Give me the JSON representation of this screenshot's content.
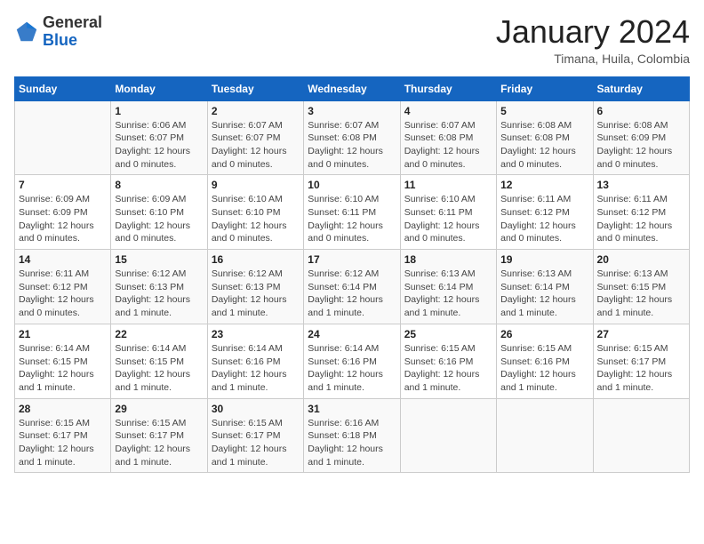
{
  "header": {
    "logo": {
      "general": "General",
      "blue": "Blue"
    },
    "title": "January 2024",
    "location": "Timana, Huila, Colombia"
  },
  "calendar": {
    "weekdays": [
      "Sunday",
      "Monday",
      "Tuesday",
      "Wednesday",
      "Thursday",
      "Friday",
      "Saturday"
    ],
    "weeks": [
      [
        {
          "day": "",
          "info": ""
        },
        {
          "day": "1",
          "info": "Sunrise: 6:06 AM\nSunset: 6:07 PM\nDaylight: 12 hours\nand 0 minutes."
        },
        {
          "day": "2",
          "info": "Sunrise: 6:07 AM\nSunset: 6:07 PM\nDaylight: 12 hours\nand 0 minutes."
        },
        {
          "day": "3",
          "info": "Sunrise: 6:07 AM\nSunset: 6:08 PM\nDaylight: 12 hours\nand 0 minutes."
        },
        {
          "day": "4",
          "info": "Sunrise: 6:07 AM\nSunset: 6:08 PM\nDaylight: 12 hours\nand 0 minutes."
        },
        {
          "day": "5",
          "info": "Sunrise: 6:08 AM\nSunset: 6:08 PM\nDaylight: 12 hours\nand 0 minutes."
        },
        {
          "day": "6",
          "info": "Sunrise: 6:08 AM\nSunset: 6:09 PM\nDaylight: 12 hours\nand 0 minutes."
        }
      ],
      [
        {
          "day": "7",
          "info": "Sunrise: 6:09 AM\nSunset: 6:09 PM\nDaylight: 12 hours\nand 0 minutes."
        },
        {
          "day": "8",
          "info": "Sunrise: 6:09 AM\nSunset: 6:10 PM\nDaylight: 12 hours\nand 0 minutes."
        },
        {
          "day": "9",
          "info": "Sunrise: 6:10 AM\nSunset: 6:10 PM\nDaylight: 12 hours\nand 0 minutes."
        },
        {
          "day": "10",
          "info": "Sunrise: 6:10 AM\nSunset: 6:11 PM\nDaylight: 12 hours\nand 0 minutes."
        },
        {
          "day": "11",
          "info": "Sunrise: 6:10 AM\nSunset: 6:11 PM\nDaylight: 12 hours\nand 0 minutes."
        },
        {
          "day": "12",
          "info": "Sunrise: 6:11 AM\nSunset: 6:12 PM\nDaylight: 12 hours\nand 0 minutes."
        },
        {
          "day": "13",
          "info": "Sunrise: 6:11 AM\nSunset: 6:12 PM\nDaylight: 12 hours\nand 0 minutes."
        }
      ],
      [
        {
          "day": "14",
          "info": "Sunrise: 6:11 AM\nSunset: 6:12 PM\nDaylight: 12 hours\nand 0 minutes."
        },
        {
          "day": "15",
          "info": "Sunrise: 6:12 AM\nSunset: 6:13 PM\nDaylight: 12 hours\nand 1 minute."
        },
        {
          "day": "16",
          "info": "Sunrise: 6:12 AM\nSunset: 6:13 PM\nDaylight: 12 hours\nand 1 minute."
        },
        {
          "day": "17",
          "info": "Sunrise: 6:12 AM\nSunset: 6:14 PM\nDaylight: 12 hours\nand 1 minute."
        },
        {
          "day": "18",
          "info": "Sunrise: 6:13 AM\nSunset: 6:14 PM\nDaylight: 12 hours\nand 1 minute."
        },
        {
          "day": "19",
          "info": "Sunrise: 6:13 AM\nSunset: 6:14 PM\nDaylight: 12 hours\nand 1 minute."
        },
        {
          "day": "20",
          "info": "Sunrise: 6:13 AM\nSunset: 6:15 PM\nDaylight: 12 hours\nand 1 minute."
        }
      ],
      [
        {
          "day": "21",
          "info": "Sunrise: 6:14 AM\nSunset: 6:15 PM\nDaylight: 12 hours\nand 1 minute."
        },
        {
          "day": "22",
          "info": "Sunrise: 6:14 AM\nSunset: 6:15 PM\nDaylight: 12 hours\nand 1 minute."
        },
        {
          "day": "23",
          "info": "Sunrise: 6:14 AM\nSunset: 6:16 PM\nDaylight: 12 hours\nand 1 minute."
        },
        {
          "day": "24",
          "info": "Sunrise: 6:14 AM\nSunset: 6:16 PM\nDaylight: 12 hours\nand 1 minute."
        },
        {
          "day": "25",
          "info": "Sunrise: 6:15 AM\nSunset: 6:16 PM\nDaylight: 12 hours\nand 1 minute."
        },
        {
          "day": "26",
          "info": "Sunrise: 6:15 AM\nSunset: 6:16 PM\nDaylight: 12 hours\nand 1 minute."
        },
        {
          "day": "27",
          "info": "Sunrise: 6:15 AM\nSunset: 6:17 PM\nDaylight: 12 hours\nand 1 minute."
        }
      ],
      [
        {
          "day": "28",
          "info": "Sunrise: 6:15 AM\nSunset: 6:17 PM\nDaylight: 12 hours\nand 1 minute."
        },
        {
          "day": "29",
          "info": "Sunrise: 6:15 AM\nSunset: 6:17 PM\nDaylight: 12 hours\nand 1 minute."
        },
        {
          "day": "30",
          "info": "Sunrise: 6:15 AM\nSunset: 6:17 PM\nDaylight: 12 hours\nand 1 minute."
        },
        {
          "day": "31",
          "info": "Sunrise: 6:16 AM\nSunset: 6:18 PM\nDaylight: 12 hours\nand 1 minute."
        },
        {
          "day": "",
          "info": ""
        },
        {
          "day": "",
          "info": ""
        },
        {
          "day": "",
          "info": ""
        }
      ]
    ]
  }
}
